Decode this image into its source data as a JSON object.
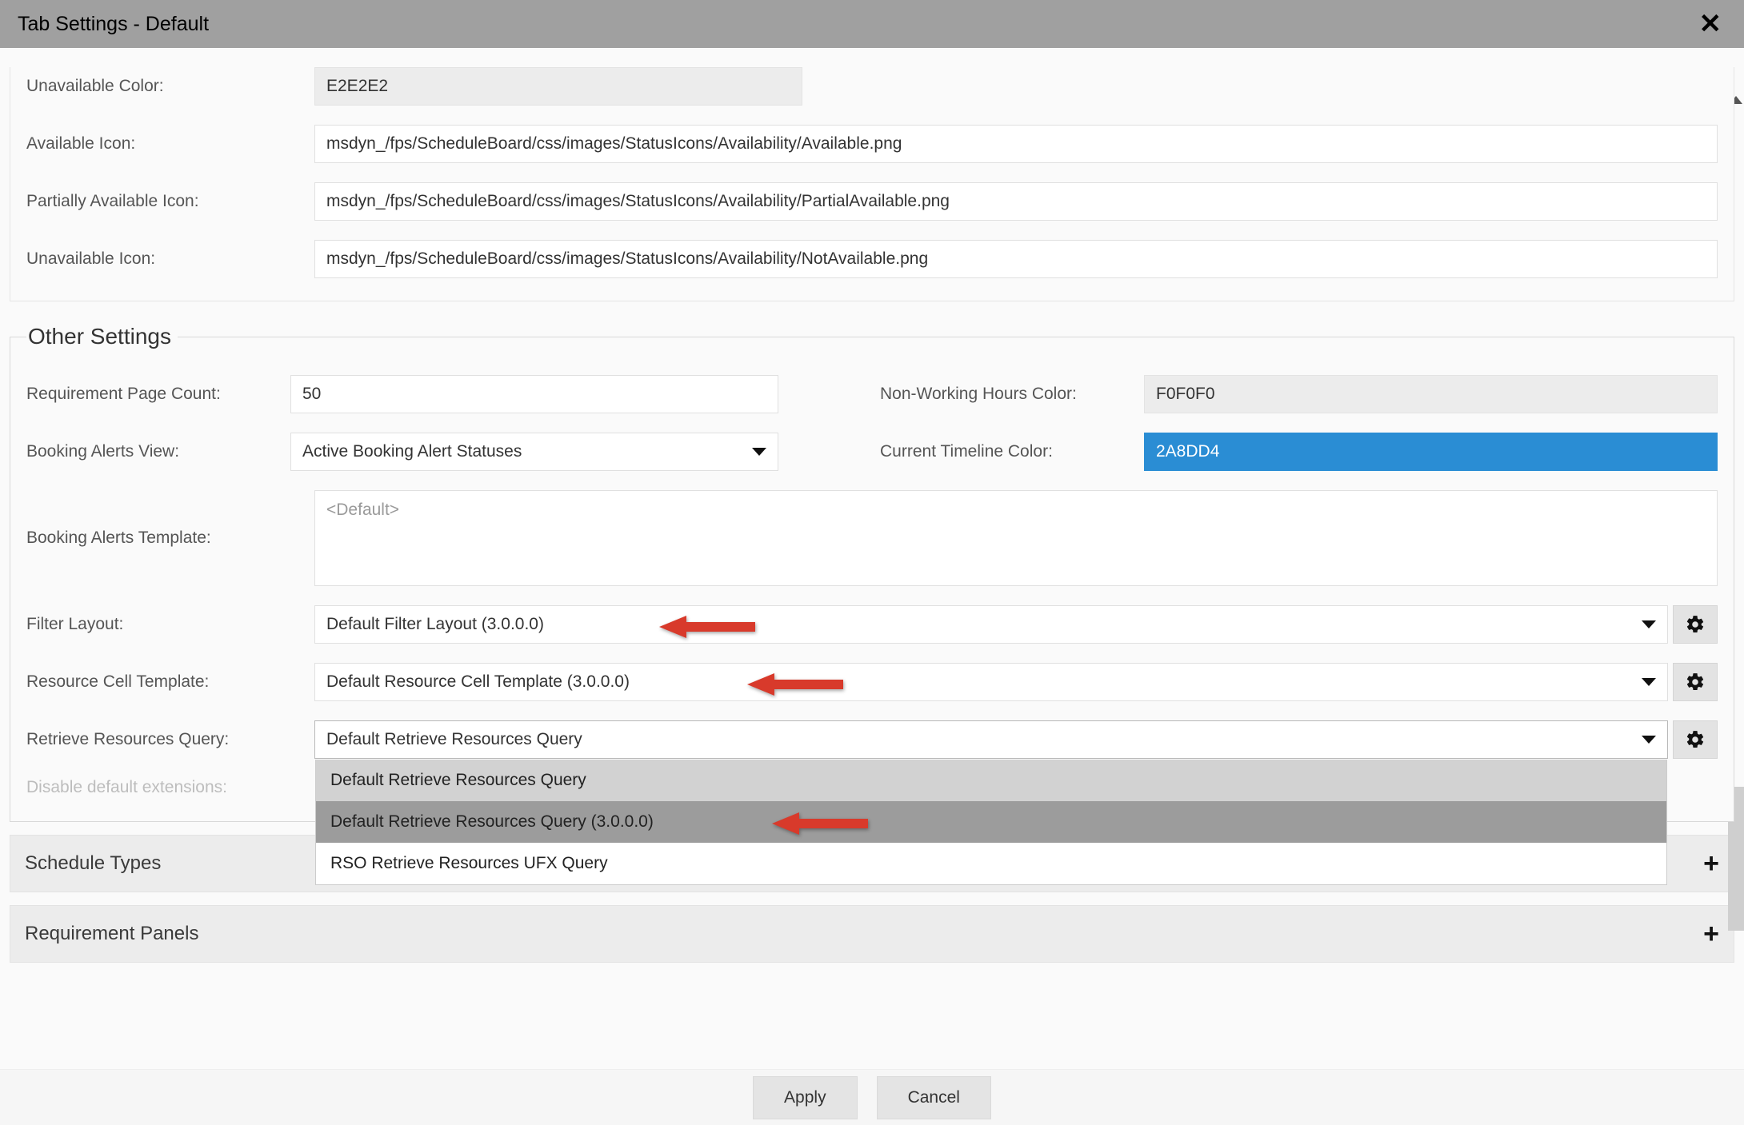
{
  "window": {
    "title": "Tab Settings - Default"
  },
  "top_fields": {
    "unavailable_color": {
      "label": "Unavailable Color:",
      "value": "E2E2E2"
    },
    "available_icon": {
      "label": "Available Icon:",
      "value": "msdyn_/fps/ScheduleBoard/css/images/StatusIcons/Availability/Available.png"
    },
    "partially_available_icon": {
      "label": "Partially Available Icon:",
      "value": "msdyn_/fps/ScheduleBoard/css/images/StatusIcons/Availability/PartialAvailable.png"
    },
    "unavailable_icon": {
      "label": "Unavailable Icon:",
      "value": "msdyn_/fps/ScheduleBoard/css/images/StatusIcons/Availability/NotAvailable.png"
    }
  },
  "other": {
    "legend": "Other Settings",
    "requirement_page_count": {
      "label": "Requirement Page Count:",
      "value": "50"
    },
    "non_working_hours_color": {
      "label": "Non-Working Hours Color:",
      "value": "F0F0F0"
    },
    "booking_alerts_view": {
      "label": "Booking Alerts View:",
      "value": "Active Booking Alert Statuses"
    },
    "current_timeline_color": {
      "label": "Current Timeline Color:",
      "value": "2A8DD4"
    },
    "booking_alerts_template": {
      "label": "Booking Alerts Template:",
      "placeholder": "<Default>"
    },
    "filter_layout": {
      "label": "Filter Layout:",
      "value": "Default Filter Layout (3.0.0.0)"
    },
    "resource_cell_template": {
      "label": "Resource Cell Template:",
      "value": "Default Resource Cell Template (3.0.0.0)"
    },
    "retrieve_resources_query": {
      "label": "Retrieve Resources Query:",
      "value": "Default Retrieve Resources Query",
      "options": [
        "Default Retrieve Resources Query",
        "Default Retrieve Resources Query (3.0.0.0)",
        "RSO Retrieve Resources UFX Query"
      ]
    },
    "disable_default_extensions": {
      "label": "Disable default extensions:"
    }
  },
  "sections": {
    "schedule_types": "Schedule Types",
    "requirement_panels": "Requirement Panels"
  },
  "buttons": {
    "apply": "Apply",
    "cancel": "Cancel"
  }
}
